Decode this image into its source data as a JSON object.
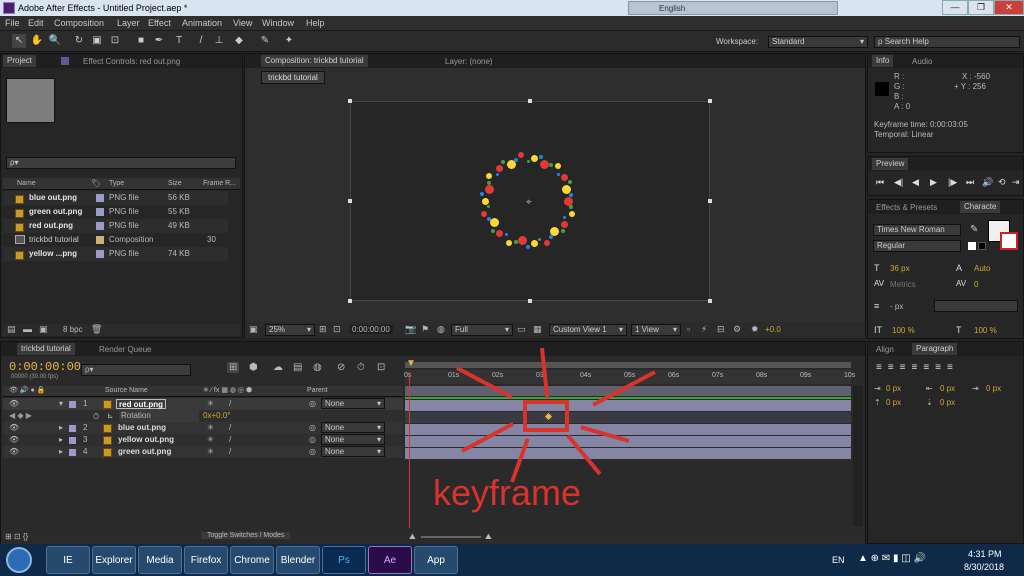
{
  "window": {
    "title": "Adobe After Effects - Untitled Project.aep *",
    "minimize": "—",
    "maximize": "❐",
    "close": "✕"
  },
  "lang_bar": {
    "lang": "English"
  },
  "menu": [
    "File",
    "Edit",
    "Composition",
    "Layer",
    "Effect",
    "Animation",
    "View",
    "Window",
    "Help"
  ],
  "toolbar": {
    "workspace_label": "Workspace:",
    "workspace_value": "Standard",
    "search_placeholder": "Search Help"
  },
  "project": {
    "tab_project": "Project",
    "tab_effect": "Effect Controls: red out.png",
    "search_placeholder": "ρ▾",
    "columns": [
      "Name",
      "Type",
      "Size",
      "Frame R..."
    ],
    "items": [
      {
        "name": "blue out.png",
        "type": "PNG file",
        "size": "56 KB",
        "rate": ""
      },
      {
        "name": "green out.png",
        "type": "PNG file",
        "size": "55 KB",
        "rate": ""
      },
      {
        "name": "red out.png",
        "type": "PNG file",
        "size": "49 KB",
        "rate": ""
      },
      {
        "name": "trickbd tutorial",
        "type": "Composition",
        "size": "",
        "rate": "30"
      },
      {
        "name": "yellow ...png",
        "type": "PNG file",
        "size": "74 KB",
        "rate": ""
      }
    ],
    "bpc": "8 bpc"
  },
  "comp": {
    "tab": "Composition: trickbd tutorial",
    "layer_tab": "Layer: (none)",
    "crumb": "trickbd tutorial",
    "zoom": "25%",
    "timecode": "0:00:00:00",
    "resolution": "Full",
    "view": "Custom View 1",
    "views": "1 View",
    "exposure": "+0.0"
  },
  "info": {
    "tab_info": "Info",
    "tab_audio": "Audio",
    "r": "R :",
    "g": "G :",
    "b": "B :",
    "a": "A : 0",
    "x": "X : -560",
    "y": "+ Y : 256",
    "kf_time": "Keyframe time: 0:00:03:05",
    "temporal": "Temporal: Linear"
  },
  "preview": {
    "tab": "Preview",
    "controls": [
      "⏮",
      "◀|",
      "◀",
      "▶",
      "|▶",
      "⏭",
      "🔊",
      "⟲",
      "⇥"
    ]
  },
  "character": {
    "tab_effects": "Effects & Presets",
    "tab_char": "Characte",
    "font": "Times New Roman",
    "style": "Regular",
    "size": "36 px",
    "leading": "Auto",
    "kerning": "Metrics",
    "tracking": "0",
    "stroke": "- px",
    "vscale": "100 %",
    "hscale": "100 %"
  },
  "paragraph": {
    "tab_align": "Align",
    "tab_para": "Paragraph",
    "indents": [
      "0 px",
      "0 px",
      "0 px",
      "0 px",
      "0 px"
    ]
  },
  "timeline": {
    "tab": "trickbd tutorial",
    "tab2": "Render Queue",
    "timecode": "0:00:00:00",
    "fps": "00000 (30.00 fps)",
    "search_placeholder": "ρ▾",
    "col_source": "Source Name",
    "col_parent": "Parent",
    "ruler": [
      "0s",
      "01s",
      "02s",
      "03s",
      "04s",
      "05s",
      "06s",
      "07s",
      "08s",
      "09s",
      "10s"
    ],
    "layers": [
      {
        "num": "1",
        "name": "red out.png",
        "parent": "None"
      },
      {
        "num": "2",
        "name": "blue out.png",
        "parent": "None"
      },
      {
        "num": "3",
        "name": "yellow out.png",
        "parent": "None"
      },
      {
        "num": "4",
        "name": "green out.png",
        "parent": "None"
      }
    ],
    "rotation_label": "Rotation",
    "rotation_value": "0x+0.0°",
    "toggle": "Toggle Switches / Modes",
    "annotation": "keyframe",
    "keyframe_time_s": 3.17
  },
  "taskbar": {
    "apps": [
      "IE",
      "Explorer",
      "Media",
      "Firefox",
      "Chrome",
      "Blender",
      "Ps",
      "Ae",
      "App"
    ],
    "lang": "EN",
    "time": "4:31 PM",
    "date": "8/30/2018"
  },
  "colors": {
    "annotation": "#d9332b",
    "timecode": "#e8b74a",
    "accent": "#3b7dd8"
  }
}
